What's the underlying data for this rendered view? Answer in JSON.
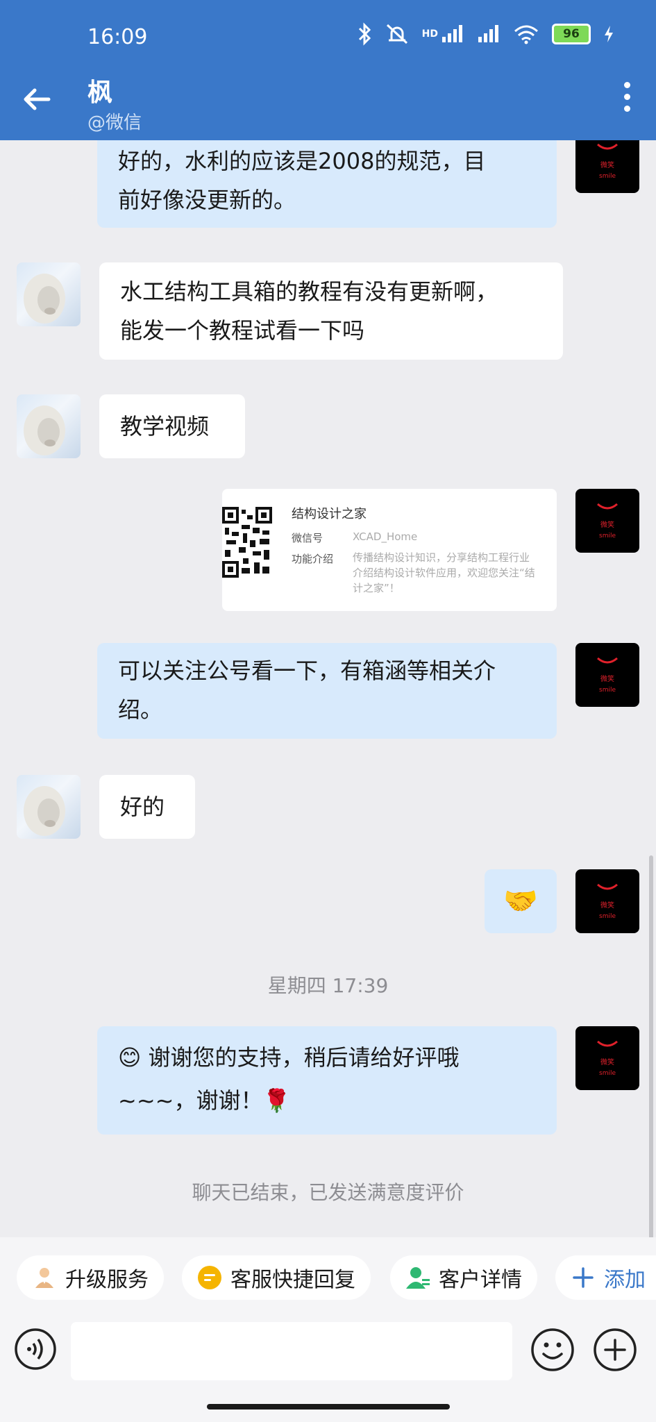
{
  "status": {
    "time": "16:09",
    "battery": "96",
    "network_label": "HD"
  },
  "header": {
    "contact_name": "枫",
    "contact_sub": "@微信"
  },
  "messages": [
    {
      "side": "out",
      "text_lines": [
        "好的，水利的应该是2008的规范，目",
        "前好像没更新的。"
      ]
    },
    {
      "side": "in",
      "text_lines": [
        "水工结构工具箱的教程有没有更新啊，",
        "能发一个教程试看一下吗"
      ]
    },
    {
      "side": "in",
      "text_lines": [
        "教学视频"
      ]
    },
    {
      "side": "out",
      "type": "card",
      "card": {
        "title": "结构设计之家",
        "id_label": "微信号",
        "id_value": "XCAD_Home",
        "intro_label": "功能介绍",
        "intro_value_lines": [
          "传播结构设计知识，分享结构工程行业",
          "介绍结构设计软件应用，欢迎您关注“结",
          "计之家”！"
        ]
      }
    },
    {
      "side": "out",
      "text_lines": [
        "可以关注公号看一下，有箱涵等相关介",
        "绍。"
      ]
    },
    {
      "side": "in",
      "text_lines": [
        "好的"
      ]
    },
    {
      "side": "out",
      "emoji": "🤝"
    },
    {
      "timestamp": "星期四 17:39"
    },
    {
      "side": "out",
      "text_lines": [
        "谢谢您的支持，稍后请给好评哦",
        "~~~，谢谢！"
      ],
      "lead_emoji": "😊",
      "trail_emoji": "🌹"
    },
    {
      "system": "聊天已结束，已发送满意度评价"
    }
  ],
  "quick_actions": [
    {
      "label": "升级服务",
      "icon": "person-icon"
    },
    {
      "label": "客服快捷回复",
      "icon": "quick-reply-icon"
    },
    {
      "label": "客户详情",
      "icon": "customer-icon"
    },
    {
      "label": "添加",
      "icon": "plus-icon"
    }
  ],
  "input": {
    "placeholder": ""
  },
  "colors": {
    "header": "#3a78c9",
    "bubble_out": "#d8eafc",
    "bubble_in": "#ffffff",
    "reply_icon": "#f5b400",
    "customer_icon": "#2eb872"
  }
}
